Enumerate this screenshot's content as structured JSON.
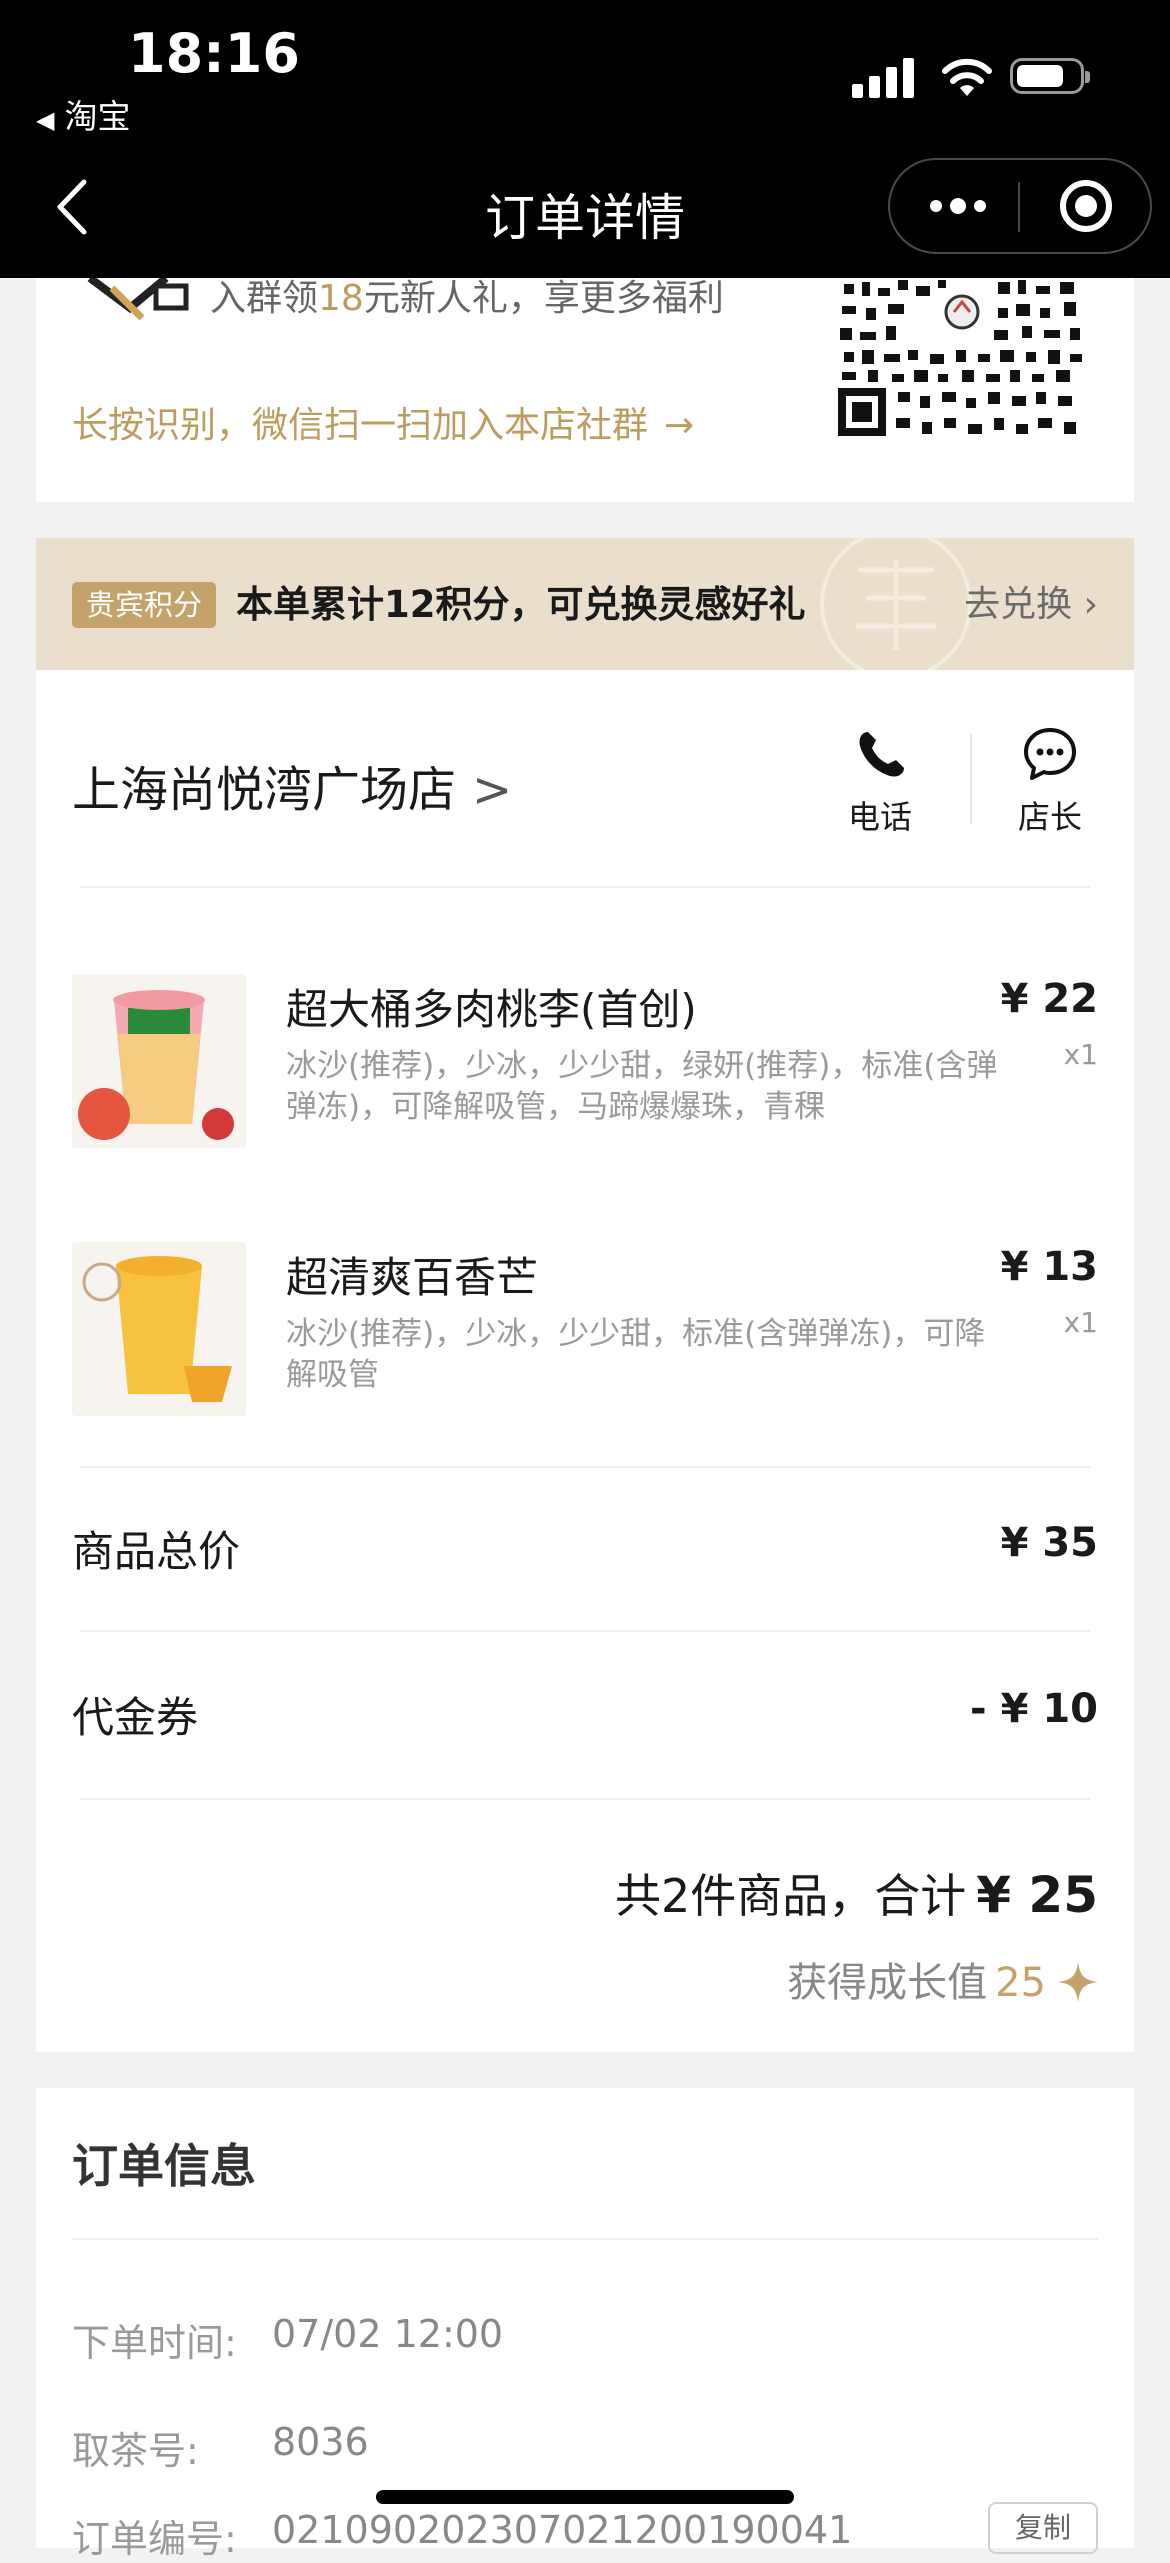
{
  "status_bar": {
    "time": "18:16",
    "back_app": "淘宝"
  },
  "nav": {
    "title": "订单详情"
  },
  "group_invite": {
    "text_pre": "入群领",
    "amount": "18",
    "text_post": "元新人礼，享更多福利",
    "scan_hint": "长按识别，微信扫一扫加入本店社群",
    "arrow": "→"
  },
  "points": {
    "badge": "贵宾积分",
    "text": "本单累计12积分，可兑换灵感好礼",
    "link": "去兑换"
  },
  "store": {
    "name": "上海尚悦湾广场店",
    "chevron": ">",
    "phone_label": "电话",
    "manager_label": "店长"
  },
  "items": [
    {
      "name": "超大桶多肉桃李(首创)",
      "desc": "冰沙(推荐)，少冰，少少甜，绿妍(推荐)，标准(含弹弹冻)，可降解吸管，马蹄爆爆珠，青稞",
      "price": "¥ 22",
      "qty": "x1"
    },
    {
      "name": "超清爽百香芒",
      "desc": "冰沙(推荐)，少冰，少少甜，标准(含弹弹冻)，可降解吸管",
      "price": "¥ 13",
      "qty": "x1"
    }
  ],
  "summary": {
    "subtotal_label": "商品总价",
    "subtotal_value": "¥ 35",
    "voucher_label": "代金券",
    "voucher_value": "- ¥ 10",
    "total_prefix": "共2件商品，合计",
    "total_value": "¥ 25",
    "growth_label": "获得成长值",
    "growth_value": "25"
  },
  "order_info": {
    "title": "订单信息",
    "rows": [
      {
        "label": "下单时间:",
        "value": "07/02 12:00"
      },
      {
        "label": "取茶号:",
        "value": "8036"
      },
      {
        "label": "订单编号:",
        "value": "021090202307021200190041"
      }
    ],
    "copy_label": "复制"
  },
  "colors": {
    "gold": "#bd9d5e",
    "points_bg": "#e9dfcc",
    "badge": "#c4a36a"
  },
  "icons": [
    "back-icon",
    "more-icon",
    "record-icon",
    "phone-icon",
    "chat-icon",
    "growth-star-icon",
    "qr-code",
    "mascot-icon"
  ]
}
